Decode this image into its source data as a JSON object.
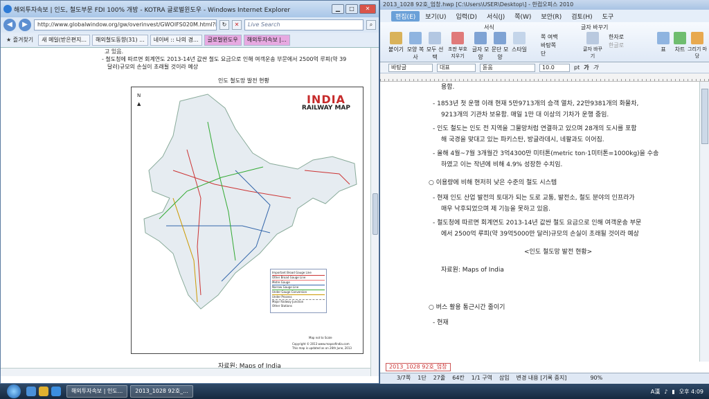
{
  "ie": {
    "title": "해외투자속보 | 인도, 철도부문 FDI 100% 개방 - KOTRA 글로벌윈도우 - Windows Internet Explorer",
    "url": "http://www.globalwindow.org/gw/overinvest/GWOIFS020M.html?BI",
    "search_placeholder": "Live Search",
    "favorites_label": "즐겨찾기",
    "tabs": [
      "새 메일(받은편지...",
      "해외철도동향(31) ...",
      "네이버 :: 나의 경...",
      "글로벌윈도우",
      "해외투자속보 |..."
    ],
    "text_line1": "고 있음.",
    "text_line2": "- 철도청에 따르면 회계연도 2013-14년 값싼 철도 요금으로 인해 여객운송 부문에서 2500억 루피(약 39",
    "text_line3": "달러)규모의 손실이 초래될 것이라 예상",
    "map_caption": "인도 철도망 발전 현황",
    "map_title1": "INDIA",
    "map_title2": "RAILWAY MAP",
    "north": "N",
    "legend": [
      "Important Broad Gauge Line",
      "Other Broad Gauge Line",
      "Metre Gauge",
      "Narrow Gauge Line",
      "Under Gauge Conversion",
      "Under Process",
      "Major Railway Junction",
      "Other Stations"
    ],
    "map_to_scale": "Map not to Scale",
    "copyright": "Copyright © 2013 www.mapsofindia.com",
    "updated": "This map is updated as on 26th June, 2013",
    "source": "자료원: Maps of India"
  },
  "hwp": {
    "title": "2013_1028 92호_업창.hwp [C:\\Users\\USER\\Desktop\\] - 한컴오피스 2010",
    "menus": [
      "편집(E)",
      "보기(U)",
      "입력(D)",
      "서식(J)",
      "쪽(W)",
      "보안(R)",
      "검토(H)",
      "도구"
    ],
    "ribbon_groups": [
      "서식",
      "글자 바꾸기"
    ],
    "ribbon_buttons": [
      "붙이기",
      "모양 복사",
      "모두 선택",
      "조판 부호 지우기",
      "글자 모양",
      "문단 모양",
      "스타일",
      "쪽 여백",
      "바탕쪽",
      "단",
      "글자 바꾸기",
      "한자로",
      "한글로",
      "표",
      "차트",
      "그리기 마당"
    ],
    "style_combo": "바탕글",
    "font_combo": "대표",
    "font_name": "돋움",
    "font_size": "10.0",
    "size_unit": "pt",
    "doc_lines": [
      "용함.",
      "- 1853년 첫 운행 이래 현재 5만9713개의 승객 열차, 22만9381개의 화물차,",
      "9213개의 기관차 보유함. 매일 1만 대 이상의 기차가 운행 중임.",
      "- 인도 철도는 인도 전 지역을 그물망처럼 연결하고 있으며 28개의 도시를 포함",
      "해 국경을 맞대고 있는 파키스탄, 방글라데시, 네팔과도 이어짐.",
      "- 올해 4월~7월 3개월간 3억4300만 미터톤(metric ton·1미터톤=1000kg)을 수송",
      "하였고 이는 작년에 비해 4.9% 성장한 수치임.",
      "○ 이용량에 비해 현저히 낮은 수준의 철도 시스템",
      "- 현재 인도 산업 발전의 토대가 되는 도로 교통, 발전소, 철도 분야의 인프라가",
      "매우 낙후되었으며 제 기능을 못하고 있음.",
      "- 철도청에 따르면 회계연도 2013-14년 값싼 철도 요금으로 인해 여객운송 부문",
      "에서 2500억 루피(약 39억5000만 달러)규모의 손실이 초래될 것이라 예상",
      "<인도 철도망 발전 현황>",
      "자료원: Maps of India",
      "○ 버스 활용 통근시간 줄이기",
      "- 현재"
    ],
    "sheet_tab": "2013_1028 92호_업창",
    "status": [
      "3/7쪽",
      "1단",
      "27줄",
      "64칸",
      "1/1 구역",
      "삽입",
      "변경 내용 [기록 중지]"
    ],
    "zoom": "90%"
  },
  "taskbar": {
    "tasks": [
      "해외투자속보 | 인도...",
      "2013_1028 92호_..."
    ],
    "clock": "오후 4:09"
  }
}
